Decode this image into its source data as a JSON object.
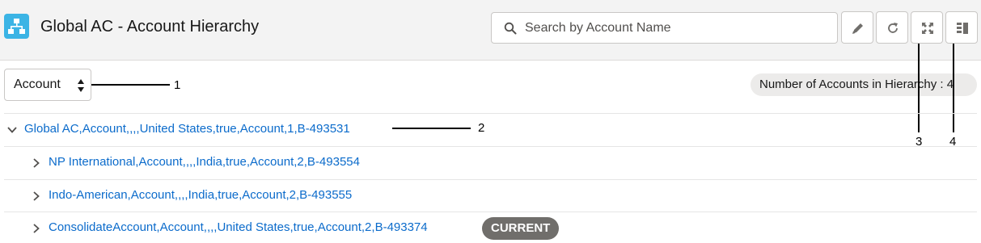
{
  "header": {
    "title": "Global AC - Account Hierarchy",
    "app_icon": "hierarchy-icon",
    "search_placeholder": "Search by Account Name",
    "buttons": [
      "edit-icon",
      "refresh-icon",
      "expand-icon",
      "columns-icon"
    ]
  },
  "toolbar": {
    "object_select_value": "Account",
    "count_label": "Number of Accounts in Hierarchy : 4"
  },
  "callouts": [
    "1",
    "2",
    "3",
    "4"
  ],
  "rows": [
    {
      "label": "Global AC,Account,,,,United States,true,Account,1,B-493531",
      "expanded": true
    },
    {
      "label": "NP International,Account,,,,India,true,Account,2,B-493554",
      "expanded": false
    },
    {
      "label": "Indo-American,Account,,,,India,true,Account,2,B-493555",
      "expanded": false
    },
    {
      "label": "ConsolidateAccount,Account,,,,United States,true,Account,2,B-493374",
      "expanded": false,
      "badge": "CURRENT"
    }
  ],
  "colors": {
    "link": "#0b6bcb",
    "app_icon_bg": "#3bb4e5",
    "badge_bg": "#706e6b"
  }
}
